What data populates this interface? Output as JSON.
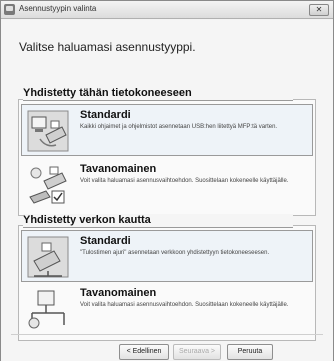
{
  "window": {
    "title": "Asennustyypin valinta",
    "close_label": "✕"
  },
  "heading": "Valitse haluamasi asennustyyppi.",
  "groups": [
    {
      "header": "Yhdistetty tähän tietokoneeseen",
      "options": [
        {
          "title": "Standardi",
          "desc": "Kaikki ohjaimet ja ohjelmistot asennetaan USB:hen liitettyä MFP:tä varten.",
          "icon": "printer-computer-icon"
        },
        {
          "title": "Tavanomainen",
          "desc": "Voit valita haluamasi asennusvaihtoehdon. Suosittelaan kokeneelle käyttäjälle.",
          "icon": "printer-custom-icon"
        }
      ]
    },
    {
      "header": "Yhdistetty verkon kautta",
      "options": [
        {
          "title": "Standardi",
          "desc": "\"Tulostimen ajuri\" asennetaan verkkoon yhdistettyyn tietokoneeseesen.",
          "icon": "network-printer-icon"
        },
        {
          "title": "Tavanomainen",
          "desc": "Voit valita haluamasi asennusvaihtoehdon. Suosittelaan kokeneelle käyttäjälle.",
          "icon": "network-custom-icon"
        }
      ]
    }
  ],
  "buttons": {
    "back": "< Edellinen",
    "next": "Seuraava >",
    "cancel": "Peruuta"
  }
}
